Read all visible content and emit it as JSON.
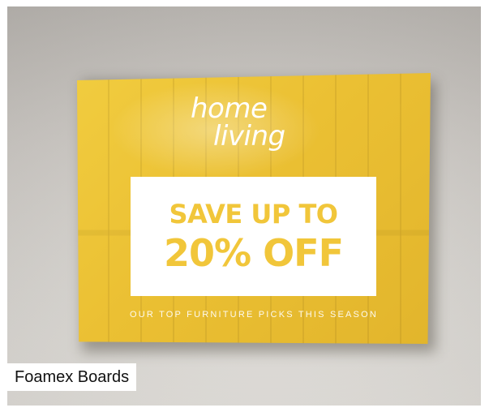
{
  "photo": {
    "logo_line1": "home",
    "logo_line2": "living",
    "promo_line1": "SAVE UP TO",
    "promo_line2": "20% OFF",
    "tagline": "OUR TOP FURNITURE PICKS THIS SEASON",
    "board_color": "#ebc033",
    "promo_text_color": "#f1c63a"
  },
  "caption": "Foamex Boards"
}
